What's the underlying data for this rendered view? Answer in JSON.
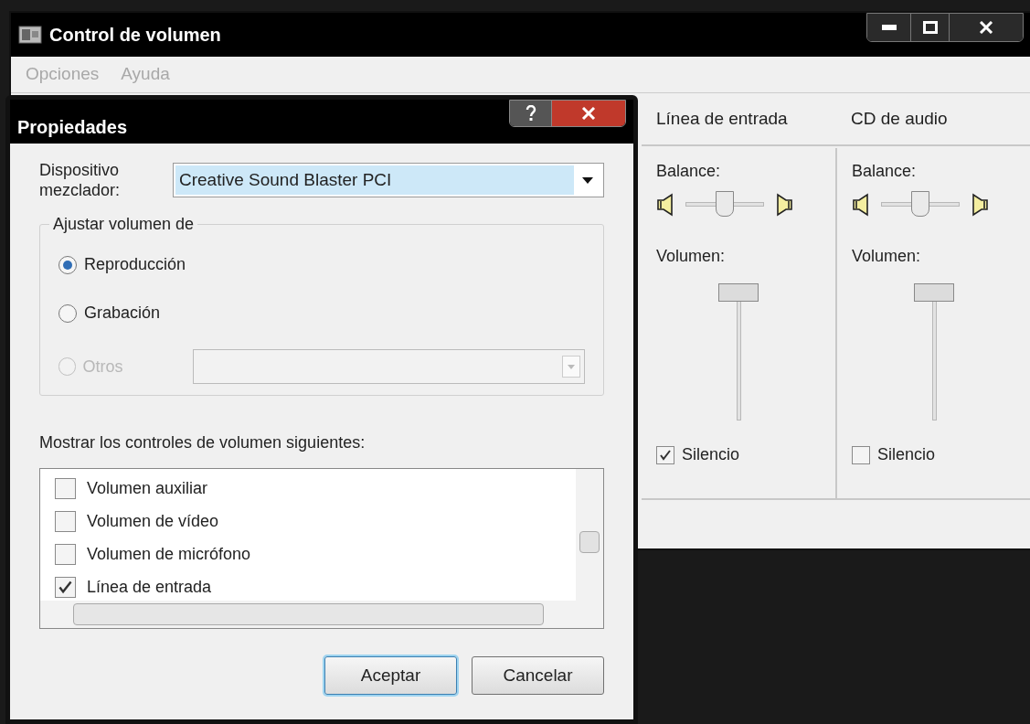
{
  "window": {
    "title": "Control de volumen",
    "menu": [
      "Opciones",
      "Ayuda"
    ]
  },
  "channels": [
    {
      "name": "Línea de entrada",
      "balance_label": "Balance:",
      "balance": {
        "level": 0.5
      },
      "volume_label": "Volumen:",
      "volume": {
        "level": 1
      },
      "mute": {
        "label": "Silencio",
        "checked": true
      }
    },
    {
      "name": "CD de audio",
      "balance_label": "Balance:",
      "balance": {
        "level": 0.5
      },
      "volume_label": "Volumen:",
      "volume": {
        "level": 1
      },
      "mute": {
        "label": "Silencio",
        "checked": false
      }
    }
  ],
  "dialog": {
    "title": "Propiedades",
    "device_label": "Dispositivo mezclador:",
    "device": "Creative Sound Blaster PCI",
    "group_title": "Ajustar volumen de",
    "options": [
      {
        "label": "Reproducción",
        "selected": true,
        "disabled": false
      },
      {
        "label": "Grabación",
        "selected": false,
        "disabled": false
      },
      {
        "label": "Otros",
        "selected": false,
        "disabled": true
      }
    ],
    "list_label": "Mostrar los controles de volumen siguientes:",
    "controls": [
      {
        "label": "Volumen auxiliar",
        "checked": false
      },
      {
        "label": "Volumen de vídeo",
        "checked": false
      },
      {
        "label": "Volumen de micrófono",
        "checked": false
      },
      {
        "label": "Línea de entrada",
        "checked": true
      }
    ],
    "buttons": [
      {
        "label": "Aceptar",
        "default": true
      },
      {
        "label": "Cancelar",
        "default": false
      }
    ]
  }
}
